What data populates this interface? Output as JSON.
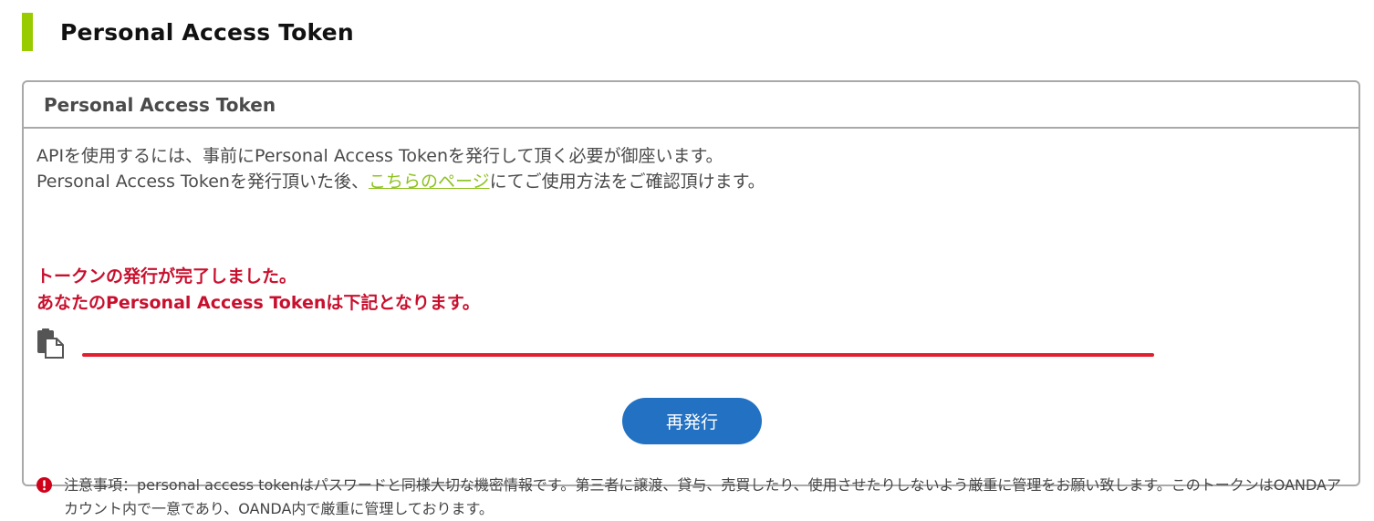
{
  "page": {
    "heading": "Personal Access Token"
  },
  "panel": {
    "title": "Personal Access Token",
    "intro_line1": "APIを使用するには、事前にPersonal Access Tokenを発行して頂く必要が御座います。",
    "intro_line2_before": "Personal Access Tokenを発行頂いた後、",
    "intro_link": "こちらのページ",
    "intro_line2_after": "にてご使用方法をご確認頂けます。",
    "success_line1": "トークンの発行が完了しました。",
    "success_line2": "あなたのPersonal Access Tokenは下記となります。",
    "reissue_button": "再発行",
    "notice": "注意事項：personal access tokenはパスワードと同様大切な機密情報です。第三者に譲渡、貸与、売買したり、使用させたりしないよう厳重に管理をお願い致します。このトークンはOANDAアカウント内で一意であり、OANDA内で厳重に管理しております。"
  },
  "icons": {
    "copy": "copy-icon",
    "notice": "exclamation-circle-icon"
  },
  "colors": {
    "accent_bar": "#99cc00",
    "link": "#8dc21f",
    "success_text": "#c8102e",
    "redaction_line": "#e02030",
    "button": "#2271c3",
    "notice_icon": "#d0021b"
  }
}
